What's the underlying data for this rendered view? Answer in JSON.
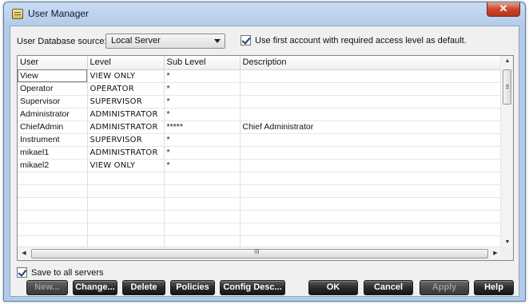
{
  "window": {
    "title": "User Manager",
    "close_glyph": "✕"
  },
  "source": {
    "label": "User Database source:",
    "selected": "Local Server"
  },
  "use_first_account": {
    "label": "Use first account with required access level as default.",
    "checked": true
  },
  "save_all": {
    "label": "Save to all servers",
    "checked": true
  },
  "table": {
    "columns": [
      "User",
      "Level",
      "Sub Level",
      "Description"
    ],
    "rows": [
      [
        "View",
        "VIEW ONLY",
        "*",
        ""
      ],
      [
        "Operator",
        "OPERATOR",
        "*",
        ""
      ],
      [
        "Supervisor",
        "SUPERVISOR",
        "*",
        ""
      ],
      [
        "Administrator",
        "ADMINISTRATOR",
        "*",
        ""
      ],
      [
        "ChiefAdmin",
        "ADMINISTRATOR",
        "*****",
        "Chief Administrator"
      ],
      [
        "Instrument",
        "SUPERVISOR",
        "*",
        ""
      ],
      [
        "mikael1",
        "ADMINISTRATOR",
        "*",
        ""
      ],
      [
        "mikael2",
        "VIEW ONLY",
        "*",
        ""
      ]
    ],
    "hscroll_grip": "III"
  },
  "buttons": {
    "new": "New...",
    "change": "Change...",
    "delete": "Delete",
    "policies": "Policies",
    "config_desc": "Config Desc...",
    "ok": "OK",
    "cancel": "Cancel",
    "apply": "Apply",
    "help": "Help"
  }
}
